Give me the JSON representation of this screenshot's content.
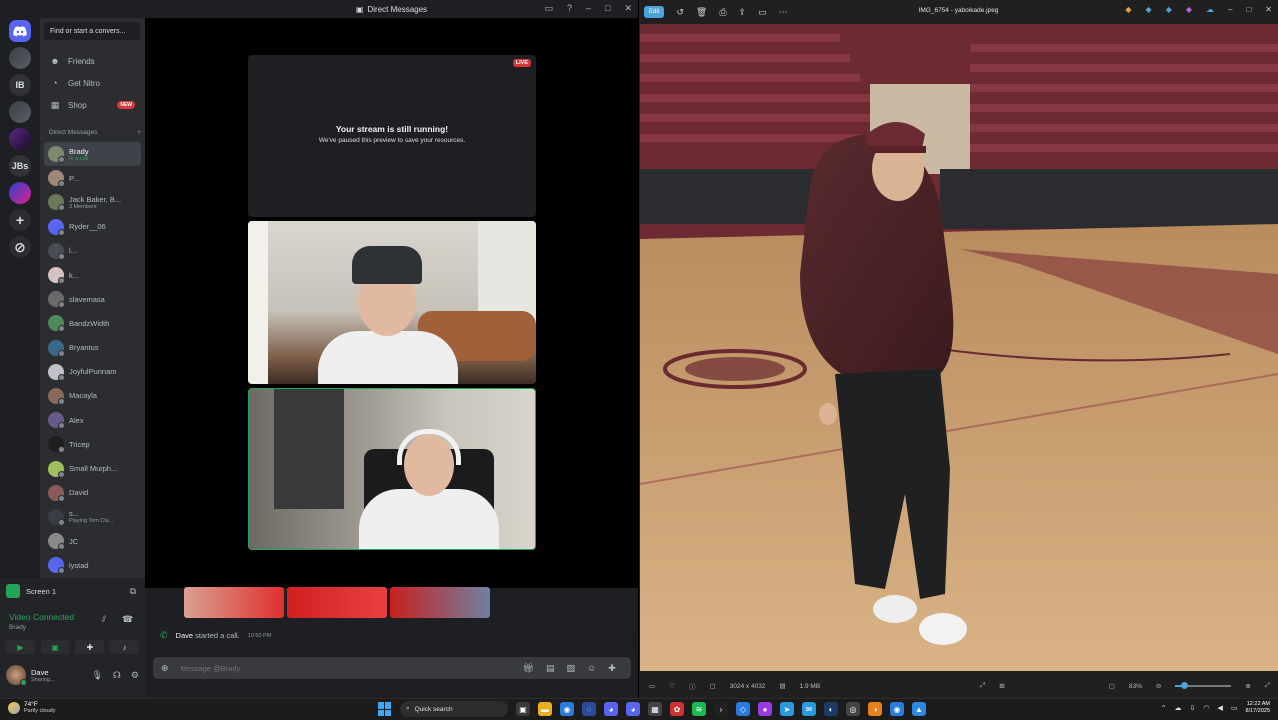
{
  "discord": {
    "window_title": "Direct Messages",
    "servers": [
      "IB",
      "JBs"
    ],
    "find_placeholder": "Find or start a convers...",
    "nav": {
      "friends": "Friends",
      "nitro": "Get Nitro",
      "shop": "Shop",
      "shop_badge": "NEW"
    },
    "dm_header": "Direct Messages",
    "dm_add": "+",
    "dms": [
      {
        "name": "Brady",
        "sub": "In a call",
        "sub_green": true,
        "active": true,
        "color": "#7a8a6a"
      },
      {
        "name": "P...",
        "sub": "",
        "color": "#a08878"
      },
      {
        "name": "Jack Baker, B...",
        "sub": "3 Members",
        "color": "#6a7a5a"
      },
      {
        "name": "Ryder__06",
        "sub": "",
        "color": "#5865f2"
      },
      {
        "name": "l...",
        "sub": "",
        "color": "#4a4d55"
      },
      {
        "name": "k...",
        "sub": "",
        "color": "#d6c2c0"
      },
      {
        "name": "slavemasa",
        "sub": "",
        "color": "#6a6a6a"
      },
      {
        "name": "BandzWidth",
        "sub": "",
        "color": "#4f8a5a"
      },
      {
        "name": "Bryantus",
        "sub": "",
        "color": "#3a6a8a"
      },
      {
        "name": "JoyfulPunnam",
        "sub": "",
        "color": "#c0c0c8"
      },
      {
        "name": "Macayla",
        "sub": "",
        "color": "#8a6a5a"
      },
      {
        "name": "Alex",
        "sub": "",
        "color": "#6a5a8a"
      },
      {
        "name": "Tricep",
        "sub": "",
        "color": "#1e1e1e"
      },
      {
        "name": "Small Murph...",
        "sub": "",
        "color": "#a0c060"
      },
      {
        "name": "David",
        "sub": "",
        "color": "#8a5a5a"
      },
      {
        "name": "s...",
        "sub": "Playing Tom Cla...",
        "sub_green": false,
        "color": "#3a3d44"
      },
      {
        "name": "JC",
        "sub": "",
        "color": "#8a8a8a"
      },
      {
        "name": "lystad",
        "sub": "",
        "color": "#5865f2"
      }
    ],
    "voice": {
      "screen_label": "Screen 1",
      "status": "Video Connected",
      "channel_user": "Brady"
    },
    "user": {
      "name": "Dave",
      "status": "Sharing..."
    },
    "stream": {
      "live": "LIVE",
      "title": "Your stream is still running!",
      "subtitle": "We've paused this preview to save your resources."
    },
    "call_message": {
      "author": "Dave",
      "text": " started a call.",
      "time": "10:50 PM"
    },
    "message_placeholder": "Message @Brady"
  },
  "photos": {
    "edit_label": "Edit",
    "file_title": "IMG_6754 - yaboikade.jpeg",
    "dimensions": "3024 x 4032",
    "file_size": "1.9 MB",
    "zoom": "83%",
    "zoom_fraction": 0.15
  },
  "taskbar": {
    "temperature": "74°F",
    "weather": "Partly cloudy",
    "search_placeholder": "Quick search",
    "time": "12:22 AM",
    "date": "8/17/2025"
  }
}
